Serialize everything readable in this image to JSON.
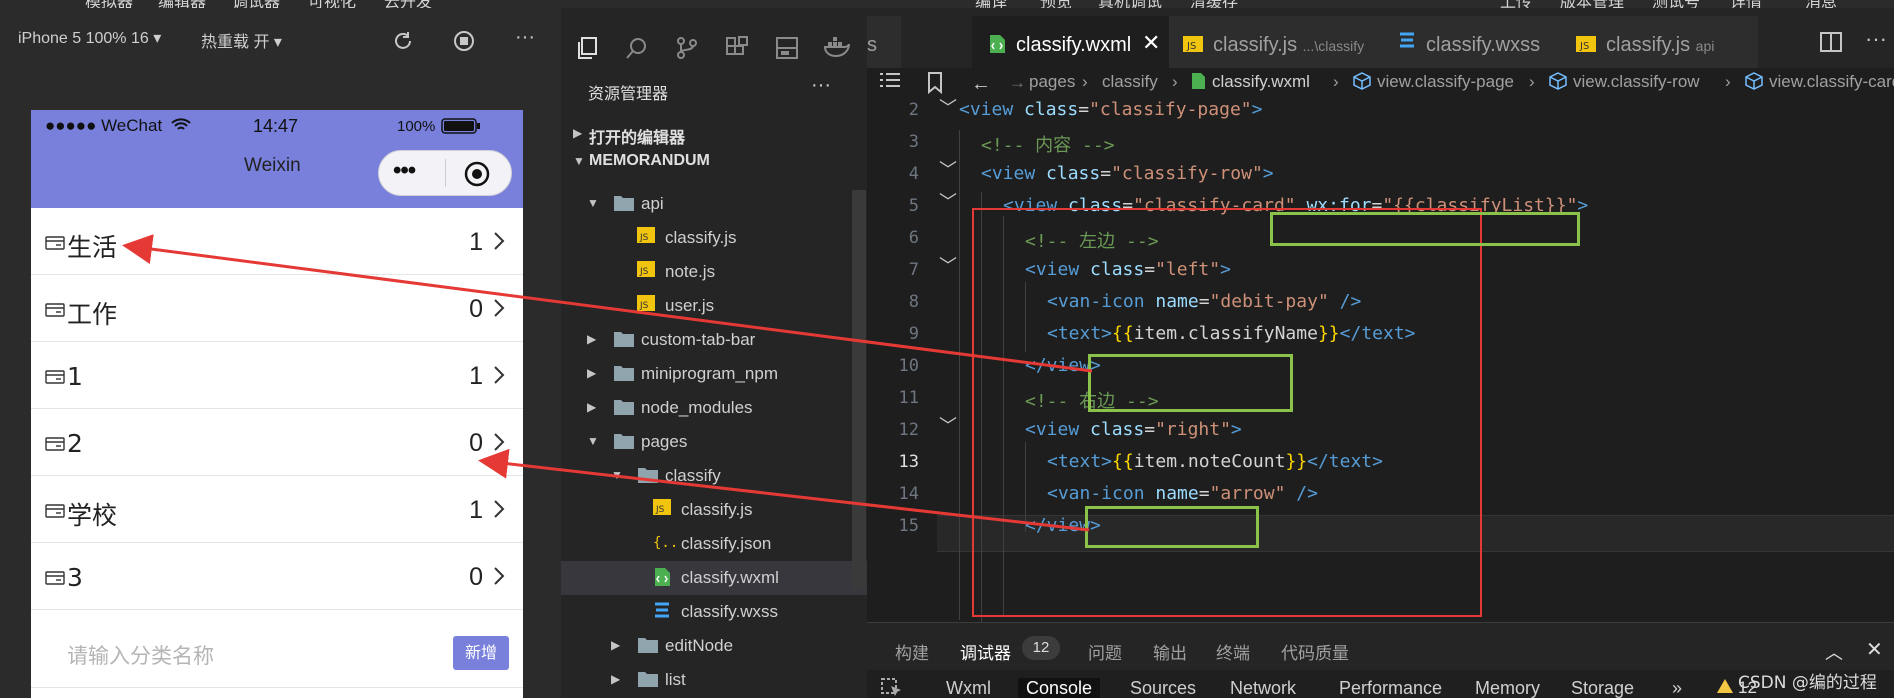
{
  "menu": {
    "items": [
      "模拟器",
      "编辑器",
      "调试器",
      "可视化",
      "云开发",
      "编译",
      "预览",
      "真机调试",
      "清缓存",
      "上传",
      "版本管理",
      "测试号",
      "详情",
      "消息"
    ]
  },
  "simulator": {
    "toolbar": {
      "device": "iPhone 5 100% 16 ▾",
      "hot_reload": "热重载 开 ▾"
    },
    "status_bar": {
      "carrier": "●●●●● WeChat",
      "time": "14:47",
      "battery": "100%"
    },
    "nav_title": "Weixin",
    "capsule_dots": "•••",
    "rows": [
      {
        "name": "生活",
        "count": "1"
      },
      {
        "name": "工作",
        "count": "0"
      },
      {
        "name": "1",
        "count": "1"
      },
      {
        "name": "2",
        "count": "0"
      },
      {
        "name": "学校",
        "count": "1"
      },
      {
        "name": "3",
        "count": "0"
      }
    ],
    "add": {
      "placeholder": "请输入分类名称",
      "button": "新增"
    }
  },
  "explorer": {
    "title": "资源管理器",
    "more": "···",
    "open_editors": "打开的编辑器",
    "project": "MEMORANDUM",
    "tree": [
      {
        "label": "api",
        "type": "folder-open",
        "depth": 1
      },
      {
        "label": "classify.js",
        "type": "js",
        "depth": 2
      },
      {
        "label": "note.js",
        "type": "js",
        "depth": 2
      },
      {
        "label": "user.js",
        "type": "js",
        "depth": 2
      },
      {
        "label": "custom-tab-bar",
        "type": "folder",
        "depth": 1
      },
      {
        "label": "miniprogram_npm",
        "type": "folder",
        "depth": 1
      },
      {
        "label": "node_modules",
        "type": "folder",
        "depth": 1
      },
      {
        "label": "pages",
        "type": "folder-open",
        "depth": 1
      },
      {
        "label": "classify",
        "type": "folder-open",
        "depth": 2
      },
      {
        "label": "classify.js",
        "type": "js",
        "depth": 3
      },
      {
        "label": "classify.json",
        "type": "json",
        "depth": 3
      },
      {
        "label": "classify.wxml",
        "type": "wxml",
        "depth": 3
      },
      {
        "label": "classify.wxss",
        "type": "wxss",
        "depth": 3
      },
      {
        "label": "editNode",
        "type": "folder",
        "depth": 2
      },
      {
        "label": "list",
        "type": "folder",
        "depth": 2
      }
    ]
  },
  "editor": {
    "tabs": [
      {
        "label": "s",
        "hint": ""
      },
      {
        "label": "classify.wxml",
        "hint": ""
      },
      {
        "label": "classify.js",
        "hint": "...\\classify"
      },
      {
        "label": "classify.wxss",
        "hint": ""
      },
      {
        "label": "classify.js",
        "hint": "api"
      }
    ],
    "breadcrumb": [
      "pages",
      "classify",
      "classify.wxml",
      "view.classify-page",
      "view.classify-row",
      "view.classify-card"
    ],
    "line_numbers": [
      "2",
      "3",
      "4",
      "5",
      "6",
      "7",
      "8",
      "9",
      "10",
      "11",
      "12",
      "13",
      "14",
      "15"
    ],
    "code": {
      "l2": [
        "<view ",
        "class",
        "=",
        "\"classify-page\"",
        ">"
      ],
      "l3": "<!-- 内容 -->",
      "l4": [
        "<view ",
        "class",
        "=",
        "\"classify-row\"",
        ">"
      ],
      "l5": [
        "<view ",
        "class",
        "=",
        "\"classify-card\"",
        " ",
        "wx:for",
        "=",
        "\"{{classifyList}}\"",
        ">"
      ],
      "l6": "<!-- 左边 -->",
      "l7": [
        "<view ",
        "class",
        "=",
        "\"left\"",
        ">"
      ],
      "l8": [
        "<van-icon ",
        "name",
        "=",
        "\"debit-pay\"",
        " />"
      ],
      "l9": [
        "<text>",
        "{{",
        "item.classifyName",
        "}}",
        "</text>"
      ],
      "l10": "</view>",
      "l11": "<!-- 右边 -->",
      "l12": [
        "<view ",
        "class",
        "=",
        "\"right\"",
        ">"
      ],
      "l13": [
        "<text>",
        "{{",
        "item.noteCount",
        "}}",
        "</text>"
      ],
      "l14": [
        "<van-icon ",
        "name",
        "=",
        "\"arrow\"",
        " />"
      ],
      "l15": "</view>"
    }
  },
  "panel": {
    "tabs": [
      "构建",
      "调试器",
      "问题",
      "输出",
      "终端",
      "代码质量"
    ],
    "badge": "12",
    "devtools_tabs": [
      "Wxml",
      "Console",
      "Sources",
      "Network",
      "Performance",
      "Memory",
      "Storage",
      "»"
    ],
    "warnings": "12",
    "watermark": "CSDN @编的过程"
  },
  "colors": {
    "accent": "#7880dc",
    "annotation_red": "#e53935",
    "annotation_green": "#8bc34a"
  }
}
